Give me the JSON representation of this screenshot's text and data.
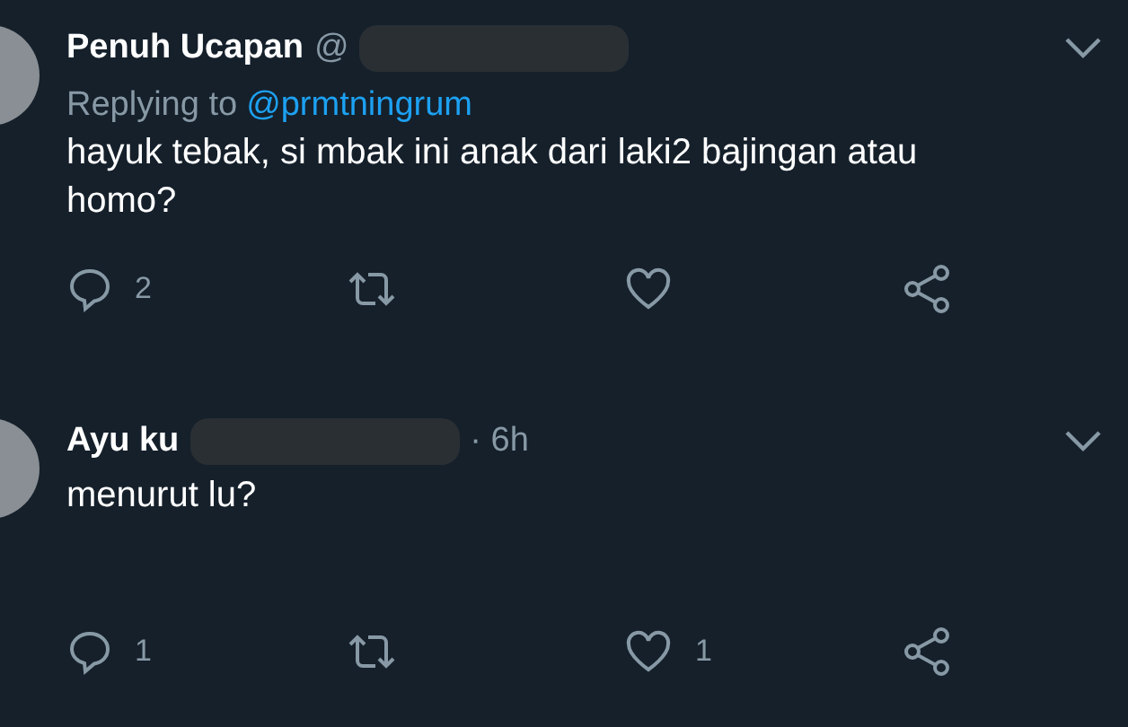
{
  "tweets": [
    {
      "name": "Penuh Ucapan",
      "handle_prefix": "@",
      "replying_to": {
        "label": "Replying to",
        "handle": "@prmtningrum"
      },
      "text": "hayuk tebak, si mbak ini anak dari laki2 bajingan atau homo?",
      "actions": {
        "replies": "2"
      }
    },
    {
      "name": "Ayu ku",
      "time": "· 6h",
      "text": "menurut lu?",
      "actions": {
        "replies": "1",
        "likes": "1"
      }
    }
  ]
}
